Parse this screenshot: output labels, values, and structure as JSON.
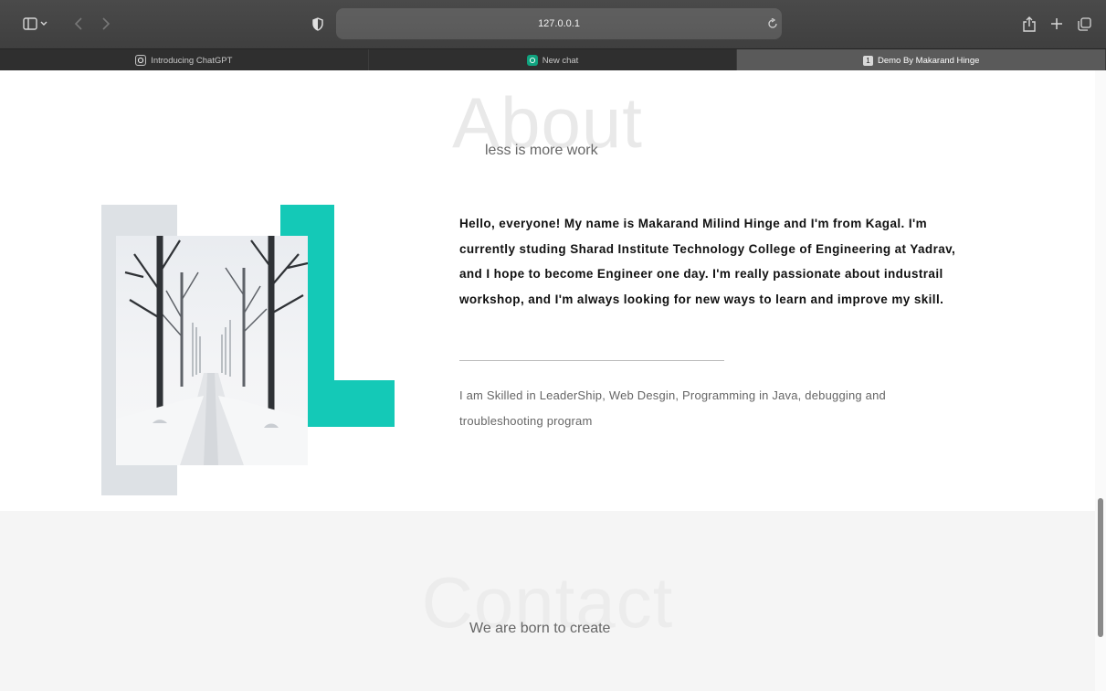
{
  "browser": {
    "url": "127.0.0.1",
    "tabs": [
      {
        "label": "Introducing ChatGPT",
        "favicon": "chatgpt-icon",
        "active": false
      },
      {
        "label": "New chat",
        "favicon": "chatgpt-green-icon",
        "active": false
      },
      {
        "label": "Demo By Makarand Hinge",
        "badge": "1",
        "active": true
      }
    ],
    "icons": {
      "sidebar": "sidebar-toggle-icon",
      "back": "chevron-left-icon",
      "forward": "chevron-right-icon",
      "privacy": "shield-icon",
      "reload": "reload-icon",
      "share": "share-icon",
      "new_tab": "plus-icon",
      "tabs_overview": "tabs-overview-icon"
    }
  },
  "about": {
    "bg_word": "About",
    "subtitle": "less is more work",
    "bio": "Hello, everyone! My name is Makarand Milind Hinge and I'm from Kagal. I'm currently studing Sharad Institute Technology College of Engineering at Yadrav, and I hope to become Engineer one day. I'm really passionate about industrail workshop, and I'm always looking for new ways to learn and improve my skill.",
    "skills": "I am Skilled in LeaderShip, Web Desgin, Programming in Java, debugging and troubleshooting program",
    "accent_color": "#14c9b7",
    "deco_color": "#dde1e5"
  },
  "contact": {
    "bg_word": "Contact",
    "subtitle": "We are born to create"
  }
}
